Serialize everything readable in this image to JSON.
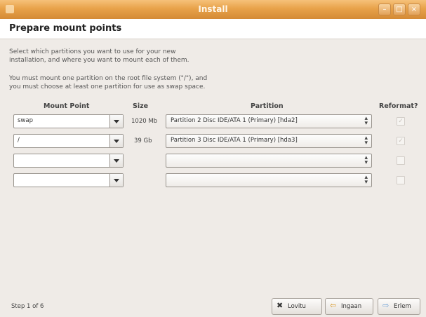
{
  "window": {
    "title": "Install"
  },
  "page": {
    "heading": "Prepare mount points",
    "para1_line1": "Select which partitions you want to use for your new",
    "para1_line2": "installation, and where you want to mount each of them.",
    "para2_line1": "You must mount one partition on the root file system (\"/\"), and",
    "para2_line2": "you must choose at least one partition for use as swap space."
  },
  "table": {
    "headers": {
      "mount_point": "Mount Point",
      "size": "Size",
      "partition": "Partition",
      "reformat": "Reformat?"
    },
    "rows": [
      {
        "mount": "swap",
        "size": "1020 Mb",
        "partition": "Partition 2 Disc IDE/ATA 1 (Primary) [hda2]",
        "reformat": "✓"
      },
      {
        "mount": "/",
        "size": "39 Gb",
        "partition": "Partition 3 Disc IDE/ATA 1 (Primary) [hda3]",
        "reformat": "✓"
      },
      {
        "mount": "",
        "size": "",
        "partition": "",
        "reformat": ""
      },
      {
        "mount": "",
        "size": "",
        "partition": "",
        "reformat": ""
      }
    ]
  },
  "footer": {
    "step": "Step 1 of 6",
    "quit_label": "Lovitu",
    "back_label": "Ingaan",
    "forward_label": "Erlem"
  },
  "icons": {
    "quit": "close-icon",
    "back": "back-arrow-icon",
    "forward": "forward-arrow-icon"
  },
  "colors": {
    "titlebar": "#e8a24a",
    "background": "#efebe7"
  }
}
